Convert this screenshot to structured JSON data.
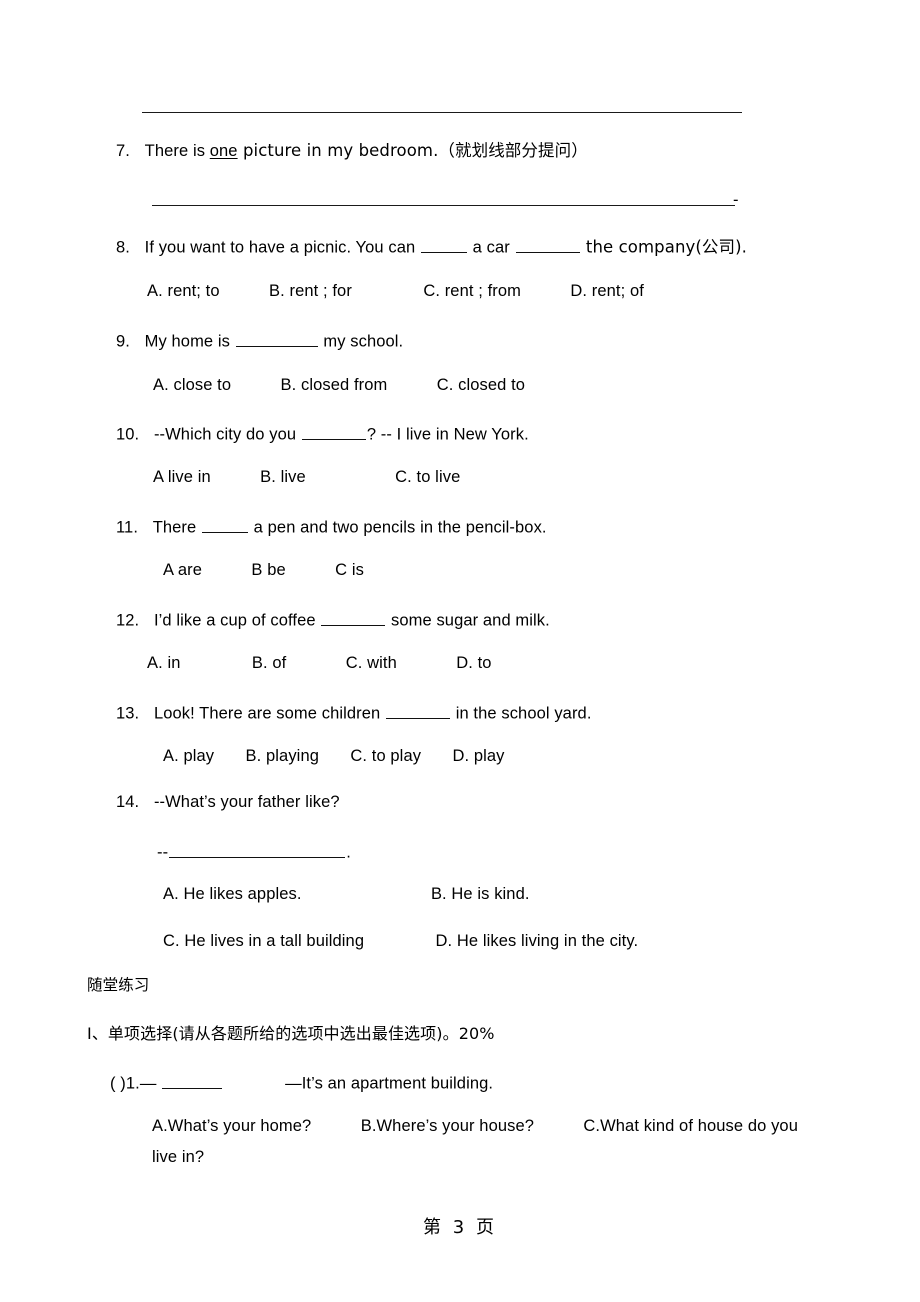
{
  "page": {
    "footer_label": "第 3 页",
    "background": "#ffffff",
    "text_color": "#000000"
  },
  "answer_lines": {
    "line_top": "",
    "line_q7": "",
    "line_q7_tail": "-"
  },
  "questions": [
    {
      "id": "q7",
      "number": "7.",
      "stem_before": "There is ",
      "stem_underlined": "one",
      "stem_after": " picture in my bedroom.（就划线部分提问）"
    },
    {
      "id": "q8",
      "number": "8.",
      "stem_part1": "If you want to have a picnic. You can ",
      "stem_part2": " a car ",
      "stem_part3": " the company(公司).",
      "options": [
        "A. rent; to",
        "B. rent ; for",
        "C. rent ; from",
        "D. rent; of"
      ]
    },
    {
      "id": "q9",
      "number": "9.",
      "stem_part1": "My home   is ",
      "stem_part2": " my school.",
      "options": [
        "A. close to",
        "B. closed from",
        "C. closed to"
      ]
    },
    {
      "id": "q10",
      "number": "10.",
      "stem_part1": "--Which city do you ",
      "stem_part2": "? -- I live in New York.",
      "options": [
        "A live   in",
        "B. live",
        "C. to live"
      ]
    },
    {
      "id": "q11",
      "number": "11.",
      "stem_part1": "There   ",
      "stem_part2": " a pen and two pencils in the pencil-box.",
      "options": [
        "A   are",
        "B be",
        "C is"
      ]
    },
    {
      "id": "q12",
      "number": "12.",
      "stem_part1": "I’d like a cup of coffee ",
      "stem_part2": " some sugar and milk.",
      "options": [
        "A. in",
        "B. of",
        "C. with",
        "D. to"
      ]
    },
    {
      "id": "q13",
      "number": "13.",
      "stem_part1": "Look! There are some children ",
      "stem_part2": " in the school yard.",
      "options": [
        "A. play",
        "B. playing",
        "C.   to play",
        "D. play"
      ]
    },
    {
      "id": "q14",
      "number": "14.",
      "stem": "--What’s your father like?",
      "answer_prefix": "--",
      "answer_suffix": ".",
      "options_row1": [
        "A. He likes apples.",
        "B. He is kind."
      ],
      "options_row2": [
        "C. He lives in a tall building",
        "D. He likes living in the city."
      ]
    }
  ],
  "practice": {
    "heading": "随堂练习",
    "section_label": "Ⅰ、单项选择(请从各题所给的选项中选出最佳选项)。20%",
    "item1": {
      "bracket": "(    )",
      "number": "1.",
      "dash_before": "— ",
      "dash_after": "—It’s an apartment building.",
      "options_line1": [
        "A.What’s your home?",
        "B.Where’s your house?",
        "C.What kind of house do you"
      ],
      "options_line2": "live in?"
    }
  }
}
